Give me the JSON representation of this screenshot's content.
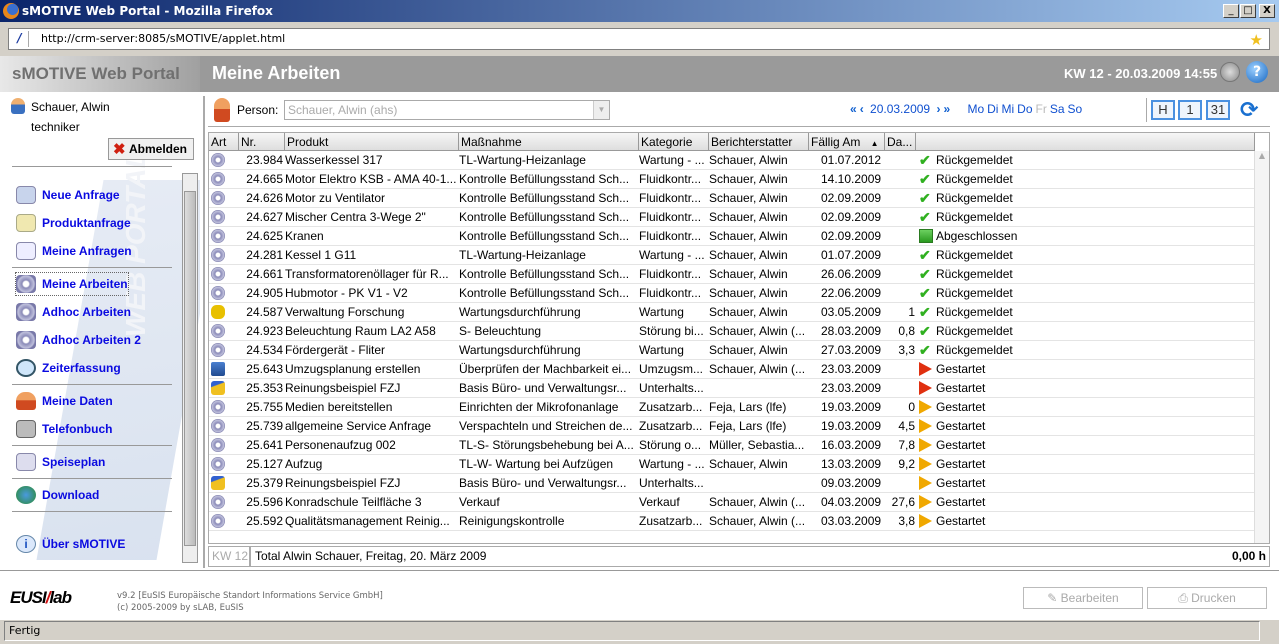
{
  "window": {
    "title": "sMOTIVE Web Portal - Mozilla Firefox",
    "minimize": "_",
    "maximize": "□",
    "close": "X",
    "url": "http://crm-server:8085/sMOTIVE/applet.html",
    "status": "Fertig"
  },
  "header": {
    "app_title": "sMOTIVE Web Portal",
    "page_title": "Meine Arbeiten",
    "datetime": "KW 12 - 20.03.2009 14:55",
    "help": "?"
  },
  "user": {
    "name": "Schauer, Alwin",
    "role": "techniker",
    "logout": "Abmelden"
  },
  "sidebar": {
    "watermark": "WEB PORTAL",
    "items": [
      {
        "label": "Neue Anfrage"
      },
      {
        "label": "Produktanfrage"
      },
      {
        "label": "Meine Anfragen"
      },
      {
        "label": "Meine Arbeiten"
      },
      {
        "label": "Adhoc Arbeiten"
      },
      {
        "label": "Adhoc Arbeiten 2"
      },
      {
        "label": "Zeiterfassung"
      },
      {
        "label": "Meine Daten"
      },
      {
        "label": "Telefonbuch"
      },
      {
        "label": "Speiseplan"
      },
      {
        "label": "Download"
      },
      {
        "label": "Über sMOTIVE"
      }
    ]
  },
  "toolbar": {
    "person_label": "Person:",
    "person_value": "Schauer, Alwin (ahs)",
    "date": "20.03.2009",
    "weekdays": [
      "Mo",
      "Di",
      "Mi",
      "Do",
      "Fr",
      "Sa",
      "So"
    ],
    "view_buttons": [
      "H",
      "1",
      "31"
    ]
  },
  "table": {
    "columns": [
      "Art",
      "Nr.",
      "Produkt",
      "Maßnahme",
      "Kategorie",
      "Berichterstatter",
      "Fällig Am",
      "Da..."
    ],
    "sort_column": "Fällig Am",
    "sort_direction": "ascending",
    "rows": [
      {
        "art": "gear",
        "nr": "23.984",
        "produkt": "Wasserkessel 317",
        "massnahme": "TL-Wartung-Heizanlage",
        "kategorie": "Wartung - ...",
        "bericht": "Schauer, Alwin",
        "faellig": "01.07.2012",
        "dauer": "",
        "status_icon": "check",
        "status": "Rückgemeldet"
      },
      {
        "art": "gear",
        "nr": "24.665",
        "produkt": "Motor Elektro KSB - AMA 40-1...",
        "massnahme": "Kontrolle Befüllungsstand Sch...",
        "kategorie": "Fluidkontr...",
        "bericht": "Schauer, Alwin",
        "faellig": "14.10.2009",
        "dauer": "",
        "status_icon": "check",
        "status": "Rückgemeldet"
      },
      {
        "art": "gear",
        "nr": "24.626",
        "produkt": "Motor zu Ventilator",
        "massnahme": "Kontrolle Befüllungsstand Sch...",
        "kategorie": "Fluidkontr...",
        "bericht": "Schauer, Alwin",
        "faellig": "02.09.2009",
        "dauer": "",
        "status_icon": "check",
        "status": "Rückgemeldet"
      },
      {
        "art": "gear",
        "nr": "24.627",
        "produkt": "Mischer Centra 3-Wege 2\"",
        "massnahme": "Kontrolle Befüllungsstand Sch...",
        "kategorie": "Fluidkontr...",
        "bericht": "Schauer, Alwin",
        "faellig": "02.09.2009",
        "dauer": "",
        "status_icon": "check",
        "status": "Rückgemeldet"
      },
      {
        "art": "gear",
        "nr": "24.625",
        "produkt": "Kranen",
        "massnahme": "Kontrolle Befüllungsstand Sch...",
        "kategorie": "Fluidkontr...",
        "bericht": "Schauer, Alwin",
        "faellig": "02.09.2009",
        "dauer": "",
        "status_icon": "square",
        "status": "Abgeschlossen"
      },
      {
        "art": "gear",
        "nr": "24.281",
        "produkt": "Kessel 1 G11",
        "massnahme": "TL-Wartung-Heizanlage",
        "kategorie": "Wartung - ...",
        "bericht": "Schauer, Alwin",
        "faellig": "01.07.2009",
        "dauer": "",
        "status_icon": "check",
        "status": "Rückgemeldet"
      },
      {
        "art": "gear",
        "nr": "24.661",
        "produkt": "Transformatorenöllager für R...",
        "massnahme": "Kontrolle Befüllungsstand Sch...",
        "kategorie": "Fluidkontr...",
        "bericht": "Schauer, Alwin",
        "faellig": "26.06.2009",
        "dauer": "",
        "status_icon": "check",
        "status": "Rückgemeldet"
      },
      {
        "art": "gear",
        "nr": "24.905",
        "produkt": "Hubmotor - PK V1 - V2",
        "massnahme": "Kontrolle Befüllungsstand Sch...",
        "kategorie": "Fluidkontr...",
        "bericht": "Schauer, Alwin",
        "faellig": "22.06.2009",
        "dauer": "",
        "status_icon": "check",
        "status": "Rückgemeldet"
      },
      {
        "art": "feet",
        "nr": "24.587",
        "produkt": "Verwaltung Forschung",
        "massnahme": "Wartungsdurchführung",
        "kategorie": "Wartung",
        "bericht": "Schauer, Alwin",
        "faellig": "03.05.2009",
        "dauer": "1",
        "status_icon": "check",
        "status": "Rückgemeldet"
      },
      {
        "art": "gear",
        "nr": "24.923",
        "produkt": "Beleuchtung Raum LA2 A58",
        "massnahme": "S- Beleuchtung",
        "kategorie": "Störung bi...",
        "bericht": "Schauer, Alwin (...",
        "faellig": "28.03.2009",
        "dauer": "0,8",
        "status_icon": "check",
        "status": "Rückgemeldet"
      },
      {
        "art": "gear",
        "nr": "24.534",
        "produkt": "Fördergerät - Fliter",
        "massnahme": "Wartungsdurchführung",
        "kategorie": "Wartung",
        "bericht": "Schauer, Alwin",
        "faellig": "27.03.2009",
        "dauer": "3,3",
        "status_icon": "check",
        "status": "Rückgemeldet"
      },
      {
        "art": "computer",
        "nr": "25.643",
        "produkt": "Umzugsplanung erstellen",
        "massnahme": "Überprüfen der Machbarkeit ei...",
        "kategorie": "Umzugsm...",
        "bericht": "Schauer, Alwin (...",
        "faellig": "23.03.2009",
        "dauer": "",
        "status_icon": "red",
        "status": "Gestartet"
      },
      {
        "art": "broom",
        "nr": "25.353",
        "produkt": "Reinungsbeispiel FZJ",
        "massnahme": "Basis  Büro- und Verwaltungsr...",
        "kategorie": "Unterhalts...",
        "bericht": "",
        "faellig": "23.03.2009",
        "dauer": "",
        "status_icon": "red",
        "status": "Gestartet"
      },
      {
        "art": "gear",
        "nr": "25.755",
        "produkt": "Medien bereitstellen",
        "massnahme": "Einrichten der Mikrofonanlage",
        "kategorie": "Zusatzarb...",
        "bericht": "Feja, Lars (lfe)",
        "faellig": "19.03.2009",
        "dauer": "0",
        "status_icon": "orange",
        "status": "Gestartet"
      },
      {
        "art": "gear",
        "nr": "25.739",
        "produkt": "allgemeine Service Anfrage",
        "massnahme": "Verspachteln und Streichen de...",
        "kategorie": "Zusatzarb...",
        "bericht": "Feja, Lars (lfe)",
        "faellig": "19.03.2009",
        "dauer": "4,5",
        "status_icon": "orange",
        "status": "Gestartet"
      },
      {
        "art": "gear",
        "nr": "25.641",
        "produkt": "Personenaufzug 002",
        "massnahme": "TL-S- Störungsbehebung bei A...",
        "kategorie": "Störung o...",
        "bericht": "Müller, Sebastia...",
        "faellig": "16.03.2009",
        "dauer": "7,8",
        "status_icon": "orange",
        "status": "Gestartet"
      },
      {
        "art": "gear",
        "nr": "25.127",
        "produkt": "Aufzug",
        "massnahme": "TL-W- Wartung bei Aufzügen",
        "kategorie": "Wartung - ...",
        "bericht": "Schauer, Alwin",
        "faellig": "13.03.2009",
        "dauer": "9,2",
        "status_icon": "orange",
        "status": "Gestartet"
      },
      {
        "art": "broom",
        "nr": "25.379",
        "produkt": "Reinungsbeispiel FZJ",
        "massnahme": "Basis  Büro- und Verwaltungsr...",
        "kategorie": "Unterhalts...",
        "bericht": "",
        "faellig": "09.03.2009",
        "dauer": "",
        "status_icon": "orange",
        "status": "Gestartet"
      },
      {
        "art": "gear",
        "nr": "25.596",
        "produkt": "Konradschule Teilfläche 3",
        "massnahme": "Verkauf",
        "kategorie": "Verkauf",
        "bericht": "Schauer, Alwin (...",
        "faellig": "04.03.2009",
        "dauer": "27,6",
        "status_icon": "orange",
        "status": "Gestartet"
      },
      {
        "art": "gear",
        "nr": "25.592",
        "produkt": "Qualitätsmanagement Reinig...",
        "massnahme": "Reinigungskontrolle",
        "kategorie": "Zusatzarb...",
        "bericht": "Schauer, Alwin (...",
        "faellig": "03.03.2009",
        "dauer": "3,8",
        "status_icon": "orange",
        "status": "Gestartet"
      }
    ]
  },
  "summary": {
    "kw": "KW 12",
    "total": "Total Alwin Schauer, Freitag, 20. März 2009",
    "hours": "0,00 h"
  },
  "footer": {
    "logo": "EUSIS slab",
    "version": "v9.2 [EuSIS Europäische Standort Informations Service GmbH]",
    "copyright": "(c) 2005-2009 by sLAB, EuSIS",
    "edit": "Bearbeiten",
    "print": "Drucken"
  }
}
